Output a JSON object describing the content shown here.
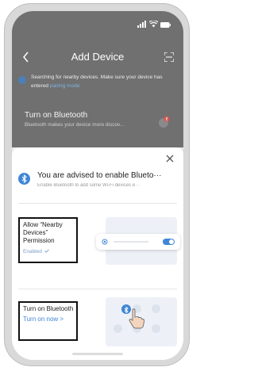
{
  "nav": {
    "title": "Add Device"
  },
  "notice": {
    "text": "Searching for nearby devices. Make sure your device has entered",
    "link": "pairing mode"
  },
  "bluetooth_row": {
    "title": "Turn on Bluetooth",
    "subtitle": "Bluetooth makes your device more discov..."
  },
  "sheet": {
    "title": "You are advised to enable Blueto···",
    "subtitle": "Enable Bluetooth to add some Wi-Fi devices e···",
    "permission": {
      "title": "Allow “Nearby Devices” Permission",
      "status": "Enabled"
    },
    "bluetooth": {
      "title": "Turn on Bluetooth",
      "link": "Turn on now >"
    }
  },
  "colors": {
    "accent": "#3f86d6",
    "overlay": "#707070",
    "frame": "#d9d9d9"
  },
  "icons": [
    "signal-icon",
    "wifi-icon",
    "battery-icon",
    "back-icon",
    "scan-icon",
    "warning-icon",
    "bluetooth-icon",
    "close-icon",
    "check-icon",
    "location-icon",
    "hand-pointer-icon"
  ]
}
